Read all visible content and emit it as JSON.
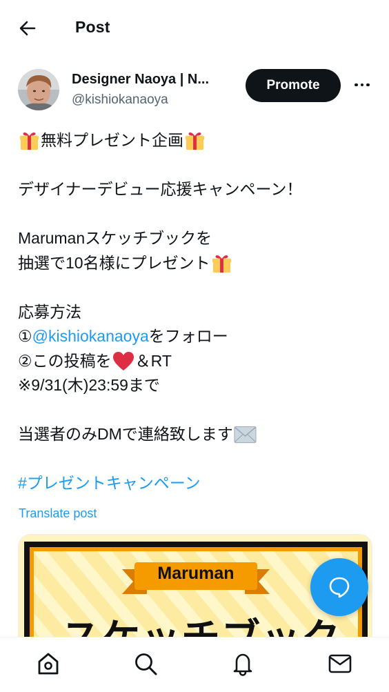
{
  "header": {
    "title": "Post"
  },
  "author": {
    "name": "Designer Naoya | N...",
    "handle": "@kishiokanaoya",
    "promote_label": "Promote"
  },
  "post": {
    "line1": "無料プレゼント企画",
    "line2": "デザイナーデビュー応援キャンペーン！",
    "line3": "Marumanスケッチブックを",
    "line4": "抽選で10名様にプレゼント",
    "line5": "応募方法",
    "line6_prefix": "①",
    "line6_mention": "@kishiokanaoya",
    "line6_suffix": "をフォロー",
    "line7_prefix": "②この投稿を",
    "line7_suffix": "＆RT",
    "line8": "※9/31(木)23:59まで",
    "line9": "当選者のみDMで連絡致します",
    "hashtag": "#プレゼントキャンペーン",
    "translate": "Translate post"
  },
  "media": {
    "banner_label": "Maruman",
    "title_text": "スケッチブック"
  },
  "icons": {
    "back": "arrow-left-icon",
    "more": "more-horizontal-icon",
    "gift": "gift-emoji",
    "heart": "red-heart-emoji",
    "mail": "envelope-emoji",
    "fab": "chat-bubble-icon",
    "nav": [
      "home-icon",
      "search-icon",
      "bell-icon",
      "mail-icon"
    ]
  },
  "colors": {
    "accent": "#1d9bf0",
    "text": "#0f1419",
    "muted": "#536471"
  }
}
